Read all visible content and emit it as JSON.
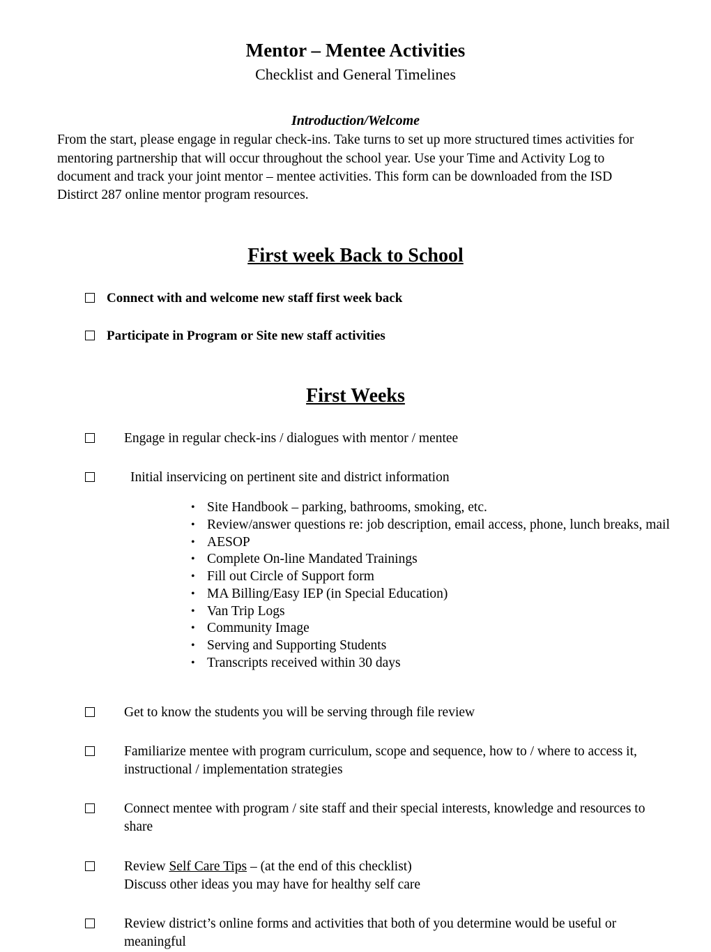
{
  "document": {
    "title": "Mentor – Mentee Activities",
    "subtitle": "Checklist and General Timelines"
  },
  "intro": {
    "heading": "Introduction/Welcome",
    "body": "From the start, please engage in regular check-ins. Take turns to set up more structured times activities for mentoring partnership that will occur throughout the school year. Use your Time and Activity Log to document and track your joint mentor – mentee activities. This form can be downloaded from the ISD Distirct 287 online mentor program resources."
  },
  "sections": [
    {
      "heading": "First week Back to School",
      "items": [
        {
          "text": "Connect with and welcome new staff first week back"
        },
        {
          "text": "Participate in Program or Site new staff activities"
        }
      ]
    },
    {
      "heading": "First Weeks",
      "items": [
        {
          "text": "Engage in regular check-ins / dialogues with mentor / mentee"
        },
        {
          "text": "Initial inservicing on pertinent site and district information"
        },
        {
          "text": "Get to know the students you will be serving through file review"
        },
        {
          "text": "Familiarize mentee with program curriculum, scope and sequence, how to / where to access it, instructional / implementation strategies"
        },
        {
          "text": "Connect mentee with program / site staff and their special interests, knowledge and resources to share"
        },
        {
          "text_prefix": "Review ",
          "text_underlined": "Self Care Tips",
          "text_suffix": " – (at the end of this checklist)",
          "text_line2": "Discuss other ideas you may have for healthy self care"
        },
        {
          "text": "Review district’s online forms and activities that both of you determine would be useful or meaningful"
        }
      ],
      "bullets": [
        "Site Handbook – parking, bathrooms, smoking, etc.",
        "Review/answer questions re: job description, email access, phone, lunch breaks, mail",
        "AESOP",
        "Complete On-line Mandated Trainings",
        "Fill out Circle of Support form",
        "MA Billing/Easy IEP (in Special Education)",
        "Van Trip Logs",
        "Community Image",
        "Serving and Supporting Students",
        "Transcripts received within 30 days"
      ]
    }
  ],
  "icons": {
    "checkbox": "empty-checkbox",
    "bullet": "•"
  }
}
